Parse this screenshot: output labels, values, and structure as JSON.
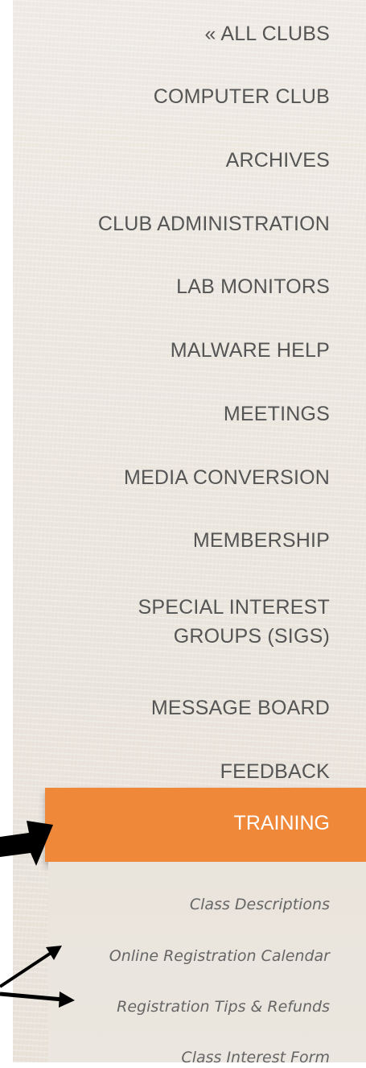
{
  "nav": {
    "items": [
      {
        "label": "« ALL CLUBS"
      },
      {
        "label": "COMPUTER CLUB"
      },
      {
        "label": "ARCHIVES"
      },
      {
        "label": "CLUB ADMINISTRATION"
      },
      {
        "label": "LAB MONITORS"
      },
      {
        "label": "MALWARE HELP"
      },
      {
        "label": "MEETINGS"
      },
      {
        "label": "MEDIA CONVERSION"
      },
      {
        "label": "MEMBERSHIP"
      },
      {
        "label": "SPECIAL INTEREST GROUPS (SIGS)"
      },
      {
        "label": "MESSAGE BOARD"
      },
      {
        "label": "FEEDBACK"
      }
    ],
    "active": {
      "label": "TRAINING"
    },
    "sub_items": [
      {
        "label": "Class Descriptions"
      },
      {
        "label": "Online Registration Calendar"
      },
      {
        "label": "Registration Tips & Refunds"
      },
      {
        "label": "Class Interest Form"
      }
    ]
  },
  "colors": {
    "accent": "#f0883a",
    "nav_text": "#555555",
    "sub_text": "#666666",
    "arrow": "#000000"
  }
}
